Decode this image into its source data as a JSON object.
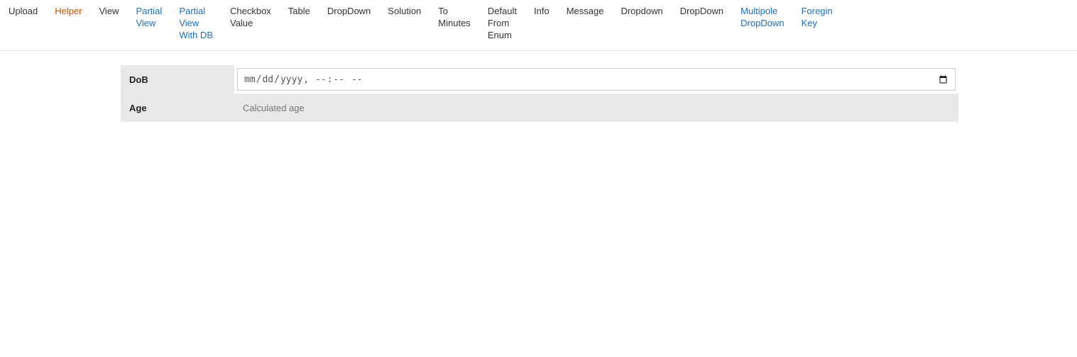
{
  "navbar": {
    "items": [
      {
        "id": "upload",
        "label": "Upload",
        "color": "dark",
        "multiline": false
      },
      {
        "id": "helper",
        "label": "Helper",
        "color": "orange",
        "multiline": false
      },
      {
        "id": "view",
        "label": "View",
        "color": "dark",
        "multiline": false
      },
      {
        "id": "partial-view",
        "label": "Partial\nView",
        "color": "blue",
        "multiline": true,
        "lines": [
          "Partial",
          "View"
        ]
      },
      {
        "id": "partial-view-with-db",
        "label": "Partial\nView\nWith DB",
        "color": "blue",
        "multiline": true,
        "lines": [
          "Partial",
          "View",
          "With DB"
        ]
      },
      {
        "id": "checkbox-value",
        "label": "Checkbox\nValue",
        "color": "dark",
        "multiline": true,
        "lines": [
          "Checkbox",
          "Value"
        ]
      },
      {
        "id": "table",
        "label": "Table",
        "color": "dark",
        "multiline": false
      },
      {
        "id": "dropdown",
        "label": "DropDown",
        "color": "dark",
        "multiline": false
      },
      {
        "id": "solution",
        "label": "Solution",
        "color": "dark",
        "multiline": false
      },
      {
        "id": "to-minutes",
        "label": "To\nMinutes",
        "color": "dark",
        "multiline": true,
        "lines": [
          "To",
          "Minutes"
        ]
      },
      {
        "id": "default-from-enum",
        "label": "Default\nFrom\nEnum",
        "color": "dark",
        "multiline": true,
        "lines": [
          "Default",
          "From",
          "Enum"
        ]
      },
      {
        "id": "info",
        "label": "Info",
        "color": "dark",
        "multiline": false
      },
      {
        "id": "message",
        "label": "Message",
        "color": "dark",
        "multiline": false
      },
      {
        "id": "dropdown2",
        "label": "Dropdown",
        "color": "dark",
        "multiline": false
      },
      {
        "id": "dropdown3",
        "label": "DropDown",
        "color": "dark",
        "multiline": false
      },
      {
        "id": "multipole-dropdown",
        "label": "Multipole\nDropDown",
        "color": "blue",
        "multiline": true,
        "lines": [
          "Multipole",
          "DropDown"
        ]
      },
      {
        "id": "foregin-key",
        "label": "Foregin\nKey",
        "color": "blue",
        "multiline": true,
        "lines": [
          "Foregin",
          "Key"
        ]
      }
    ]
  },
  "form": {
    "dob_label": "DoB",
    "dob_placeholder": "dd-----yyyy --:-- --",
    "age_label": "Age",
    "age_placeholder": "Calculated age"
  }
}
